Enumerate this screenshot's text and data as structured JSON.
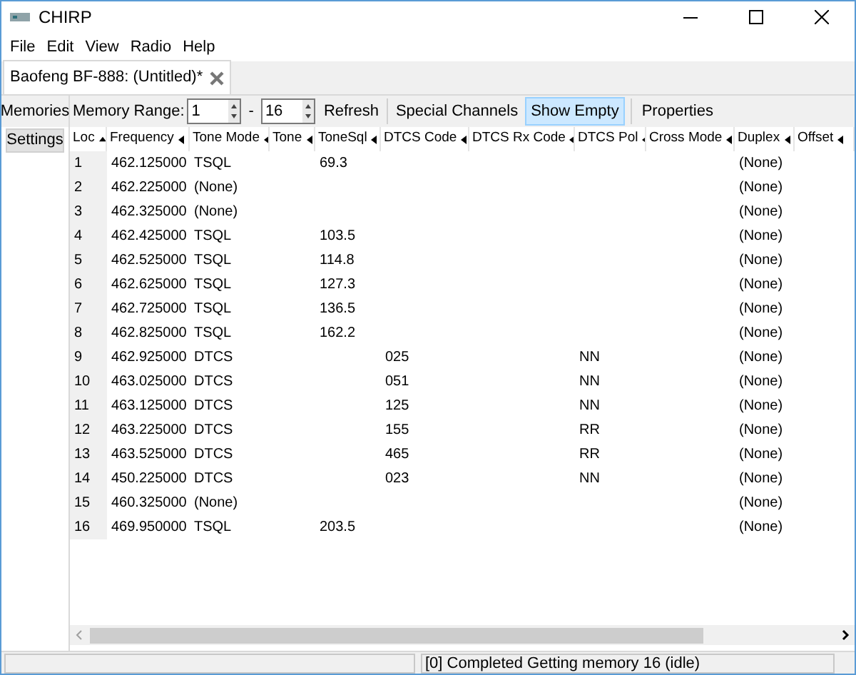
{
  "window": {
    "title": "CHIRP"
  },
  "menu": [
    "File",
    "Edit",
    "View",
    "Radio",
    "Help"
  ],
  "tabs": [
    {
      "label": "Baofeng BF-888: (Untitled)*",
      "selected": true
    }
  ],
  "side_tabs": [
    {
      "label": "Memories",
      "selected": true
    },
    {
      "label": "Settings",
      "selected": false
    }
  ],
  "toolbar": {
    "range_label": "Memory Range:",
    "range_from": "1",
    "range_sep": "-",
    "range_to": "16",
    "refresh": "Refresh",
    "special_channels": {
      "label": "Special Channels",
      "selected": false
    },
    "show_empty": {
      "label": "Show Empty",
      "selected": true
    },
    "properties": "Properties"
  },
  "table": {
    "columns": [
      {
        "label": "Loc",
        "sorted": true
      },
      {
        "label": "Frequency",
        "sorted": false
      },
      {
        "label": "Tone Mode",
        "sorted": false
      },
      {
        "label": "Tone",
        "sorted": false
      },
      {
        "label": "ToneSql",
        "sorted": false
      },
      {
        "label": "DTCS Code",
        "sorted": false
      },
      {
        "label": "DTCS Rx Code",
        "sorted": false
      },
      {
        "label": "DTCS Pol",
        "sorted": false
      },
      {
        "label": "Cross Mode",
        "sorted": false
      },
      {
        "label": "Duplex",
        "sorted": false
      },
      {
        "label": "Offset",
        "sorted": false
      }
    ],
    "rows": [
      [
        "1",
        "462.125000",
        "TSQL",
        null,
        "69.3",
        null,
        null,
        null,
        null,
        "(None)",
        null
      ],
      [
        "2",
        "462.225000",
        "(None)",
        null,
        null,
        null,
        null,
        null,
        null,
        "(None)",
        null
      ],
      [
        "3",
        "462.325000",
        "(None)",
        null,
        null,
        null,
        null,
        null,
        null,
        "(None)",
        null
      ],
      [
        "4",
        "462.425000",
        "TSQL",
        null,
        "103.5",
        null,
        null,
        null,
        null,
        "(None)",
        null
      ],
      [
        "5",
        "462.525000",
        "TSQL",
        null,
        "114.8",
        null,
        null,
        null,
        null,
        "(None)",
        null
      ],
      [
        "6",
        "462.625000",
        "TSQL",
        null,
        "127.3",
        null,
        null,
        null,
        null,
        "(None)",
        null
      ],
      [
        "7",
        "462.725000",
        "TSQL",
        null,
        "136.5",
        null,
        null,
        null,
        null,
        "(None)",
        null
      ],
      [
        "8",
        "462.825000",
        "TSQL",
        null,
        "162.2",
        null,
        null,
        null,
        null,
        "(None)",
        null
      ],
      [
        "9",
        "462.925000",
        "DTCS",
        null,
        null,
        "025",
        null,
        "NN",
        null,
        "(None)",
        null
      ],
      [
        "10",
        "463.025000",
        "DTCS",
        null,
        null,
        "051",
        null,
        "NN",
        null,
        "(None)",
        null
      ],
      [
        "11",
        "463.125000",
        "DTCS",
        null,
        null,
        "125",
        null,
        "NN",
        null,
        "(None)",
        null
      ],
      [
        "12",
        "463.225000",
        "DTCS",
        null,
        null,
        "155",
        null,
        "RR",
        null,
        "(None)",
        null
      ],
      [
        "13",
        "463.525000",
        "DTCS",
        null,
        null,
        "465",
        null,
        "RR",
        null,
        "(None)",
        null
      ],
      [
        "14",
        "450.225000",
        "DTCS",
        null,
        null,
        "023",
        null,
        "NN",
        null,
        "(None)",
        null
      ],
      [
        "15",
        "460.325000",
        "(None)",
        null,
        null,
        null,
        null,
        null,
        null,
        "(None)",
        null
      ],
      [
        "16",
        "469.950000",
        "TSQL",
        null,
        "203.5",
        null,
        null,
        null,
        null,
        "(None)",
        null
      ]
    ]
  },
  "status_bar": {
    "message": "[0] Completed Getting memory 16 (idle)"
  }
}
